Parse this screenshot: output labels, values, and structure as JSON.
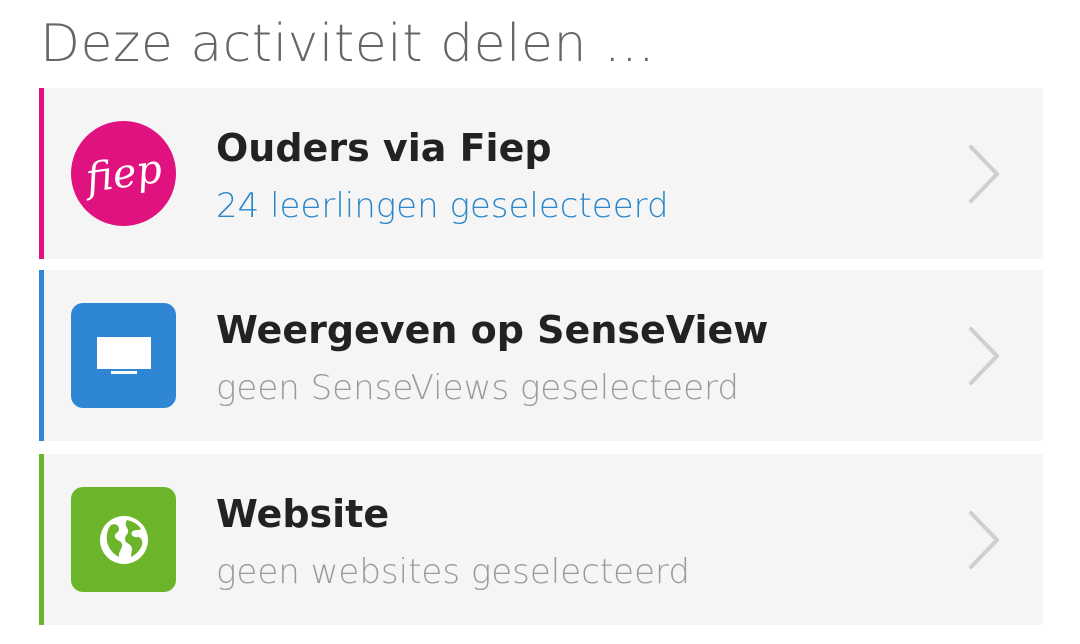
{
  "page": {
    "title": "Deze activiteit delen ..."
  },
  "colors": {
    "fiep": "#e0127f",
    "senseview": "#2f86d4",
    "website": "#6cb52b",
    "subtitle_active": "#2a86c8",
    "subtitle_muted": "#9a9a9a",
    "chevron": "#cfcfcf"
  },
  "items": [
    {
      "title": "Ouders via Fiep",
      "subtitle": "24 leerlingen geselecteerd",
      "icon_name": "fiep-logo-icon",
      "logo_text": "fiep"
    },
    {
      "title": "Weergeven op SenseView",
      "subtitle": "geen SenseViews geselecteerd",
      "icon_name": "monitor-icon"
    },
    {
      "title": "Website",
      "subtitle": "geen websites geselecteerd",
      "icon_name": "globe-icon"
    }
  ]
}
